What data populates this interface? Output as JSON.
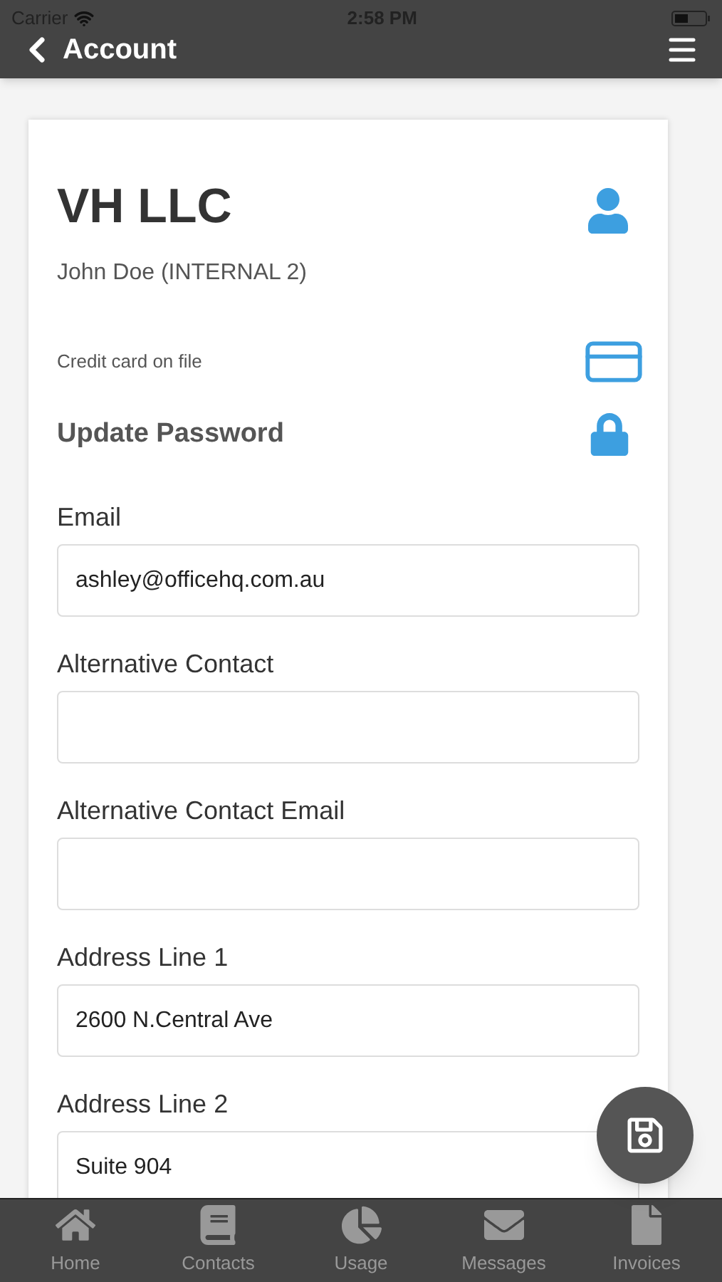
{
  "status_bar": {
    "carrier": "Carrier",
    "time": "2:58 PM"
  },
  "header": {
    "title": "Account"
  },
  "account": {
    "company": "VH LLC",
    "contact": "John Doe (INTERNAL 2)",
    "credit_card": "Credit card on file",
    "update_password": "Update Password"
  },
  "fields": [
    {
      "label": "Email",
      "value": "ashley@officehq.com.au"
    },
    {
      "label": "Alternative Contact"
    },
    {
      "label": "Alternative Contact Email"
    },
    {
      "label": "Address Line 1",
      "value": "2600 N.Central Ave"
    },
    {
      "label": "Address Line 2",
      "value": "Suite 904"
    }
  ],
  "tab_bar": [
    {
      "kind": "home",
      "label": "Home"
    },
    {
      "kind": "contacts",
      "label": "Contacts"
    },
    {
      "kind": "usage",
      "label": "Usage"
    },
    {
      "kind": "messages",
      "label": "Messages"
    },
    {
      "kind": "invoices",
      "label": "Invoices"
    }
  ]
}
